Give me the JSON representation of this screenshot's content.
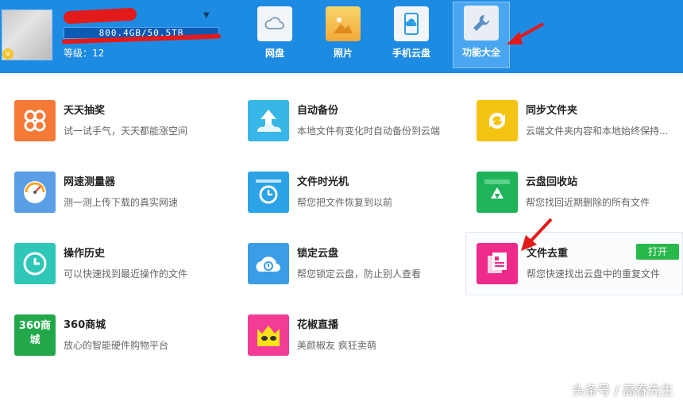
{
  "header": {
    "storage": "800.4GB/50.5TB",
    "level": "等级：12"
  },
  "nav": [
    {
      "label": "网盘",
      "icon": "cloud-drive-icon"
    },
    {
      "label": "照片",
      "icon": "photo-icon"
    },
    {
      "label": "手机云盘",
      "icon": "mobile-cloud-icon"
    },
    {
      "label": "功能大全",
      "icon": "tools-icon",
      "active": true
    }
  ],
  "features": [
    {
      "title": "天天抽奖",
      "desc": "试一试手气，天天都能涨空间",
      "color": "#f47a36",
      "icon": "lottery-icon"
    },
    {
      "title": "自动备份",
      "desc": "本地文件有变化时自动备份到云端",
      "color": "#39b6e8",
      "icon": "upload-cloud-icon"
    },
    {
      "title": "同步文件夹",
      "desc": "云端文件夹内容和本地始终保持...",
      "color": "#f5c412",
      "icon": "sync-folder-icon"
    },
    {
      "title": "网速测量器",
      "desc": "测一测上传下载的真实网速",
      "color": "#5a9ee6",
      "icon": "speedometer-icon"
    },
    {
      "title": "文件时光机",
      "desc": "帮您把文件恢复到以前",
      "color": "#2ba3e6",
      "icon": "time-machine-icon"
    },
    {
      "title": "云盘回收站",
      "desc": "帮您找回近期删除的所有文件",
      "color": "#1fb35a",
      "icon": "recycle-bin-icon"
    },
    {
      "title": "操作历史",
      "desc": "可以快速找到最近操作的文件",
      "color": "#2ec7b8",
      "icon": "history-clock-icon"
    },
    {
      "title": "锁定云盘",
      "desc": "帮您锁定云盘，防止别人查看",
      "color": "#3a9de6",
      "icon": "lock-cloud-icon"
    },
    {
      "title": "文件去重",
      "desc": "帮您快速找出云盘中的重复文件",
      "color": "#ee2a8a",
      "icon": "dedupe-files-icon",
      "button": "打开"
    },
    {
      "title": "360商城",
      "desc": "放心的智能硬件购物平台",
      "color": "#22a84a",
      "icon": "store-icon",
      "icon_text": "360商城"
    },
    {
      "title": "花椒直播",
      "desc": "美颜椒友 疯狂卖萌",
      "color": "#f23c96",
      "icon": "huajiao-live-icon"
    }
  ],
  "watermark": "头条号 / 高春先生",
  "colors": {
    "header": "#1e8be3",
    "accent_arrow": "#e21a1a",
    "open_button": "#29b84a"
  }
}
